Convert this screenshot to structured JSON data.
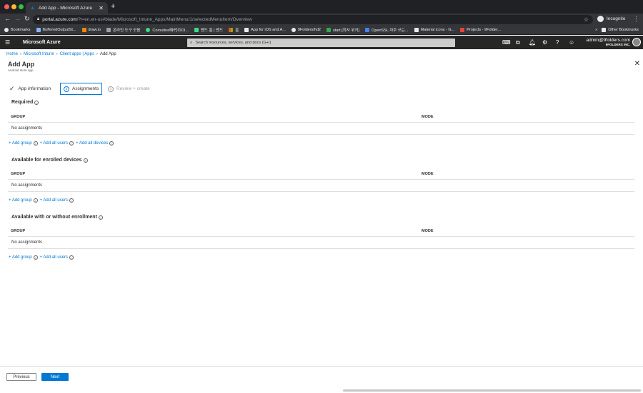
{
  "browser": {
    "tab_title": "Add App - Microsoft Azure",
    "url_host": "portal.azure.com",
    "url_path": "/?l=en.en-us#blade/Microsoft_Intune_Apps/MainMenu/1/selectedMenuItem/Overview",
    "incognito_label": "Incognito",
    "bookmarks": [
      {
        "label": "Bookmarks",
        "color": "#e8eaed"
      },
      {
        "label": "BufferedOutputSt...",
        "color": "#8ab4f8"
      },
      {
        "label": "draw.io",
        "color": "#f08705"
      },
      {
        "label": "온라인 도구 모음",
        "color": "#9aa0a6"
      },
      {
        "label": "Coroutine時代のDI...",
        "color": "#3ddc84"
      },
      {
        "label": "밴드 홈 | 밴드",
        "color": "#3ddc84"
      },
      {
        "label": "홈",
        "color": "#f25022"
      },
      {
        "label": "App for iOS and A...",
        "color": "#e8eaed"
      },
      {
        "label": "9Folders/hd2",
        "color": "#e8eaed"
      },
      {
        "label": "start [회사 위키]",
        "color": "#34a853"
      },
      {
        "label": "OpenSSL 자주 쓰는...",
        "color": "#4285f4"
      },
      {
        "label": "Material icons - G...",
        "color": "#e8eaed"
      },
      {
        "label": "Projects - 9Folder...",
        "color": "#ea4335"
      }
    ],
    "other_bookmarks": "Other Bookmarks"
  },
  "azure": {
    "brand": "Microsoft Azure",
    "search_placeholder": "Search resources, services, and docs (G+/)",
    "user_name": "admin@9folders.com",
    "user_org": "9FOLDERS INC."
  },
  "breadcrumb": [
    {
      "label": "Home"
    },
    {
      "label": "Microsoft Intune"
    },
    {
      "label": "Client apps | Apps"
    },
    {
      "label": "Add App"
    }
  ],
  "page": {
    "title": "Add App",
    "subtitle": "Android store app"
  },
  "steps": [
    {
      "label": "App information",
      "state": "done"
    },
    {
      "num": "2",
      "label": "Assignments",
      "state": "active"
    },
    {
      "num": "3",
      "label": "Review + create",
      "state": "disabled"
    }
  ],
  "sections": [
    {
      "title": "Required",
      "col_group": "GROUP",
      "col_mode": "MODE",
      "empty": "No assignments",
      "links": [
        "+ Add group",
        "+ Add all users",
        "+ Add all devices"
      ]
    },
    {
      "title": "Available for enrolled devices",
      "col_group": "GROUP",
      "col_mode": "MODE",
      "empty": "No assignments",
      "links": [
        "+ Add group",
        "+ Add all users"
      ]
    },
    {
      "title": "Available with or without enrollment",
      "col_group": "GROUP",
      "col_mode": "MODE",
      "empty": "No assignments",
      "links": [
        "+ Add group",
        "+ Add all users"
      ]
    }
  ],
  "footer": {
    "previous": "Previous",
    "next": "Next"
  },
  "colors": {
    "accent": "#0078d4",
    "azure_bar": "#262626",
    "chrome_dark": "#202124"
  }
}
